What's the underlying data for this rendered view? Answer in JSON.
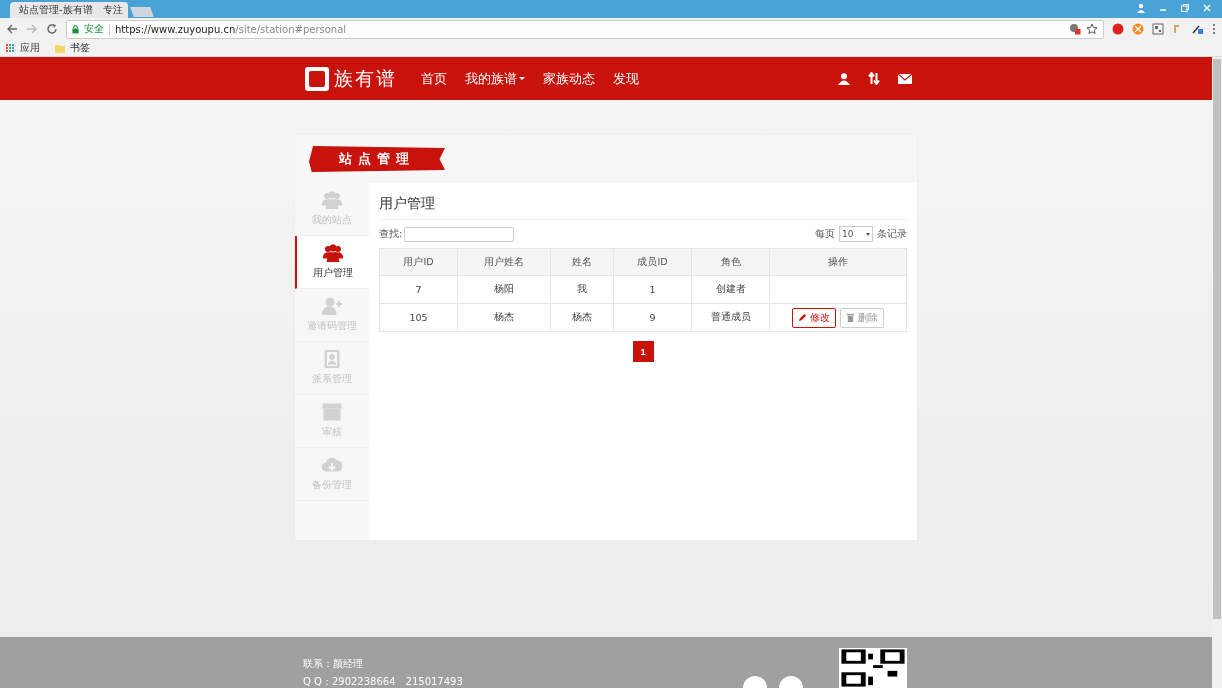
{
  "browser": {
    "tab_title": "站点管理-族有谱　专注",
    "security_label": "安全",
    "url_host": "https://www.zuyoupu.cn",
    "url_path": "/site/station#personal",
    "bookmarks": [
      {
        "kind": "apps",
        "label": "应用"
      },
      {
        "kind": "folder",
        "label": "书签"
      }
    ]
  },
  "header": {
    "logo_text": "族有谱",
    "nav": [
      {
        "label": "首页",
        "dropdown": false
      },
      {
        "label": "我的族谱",
        "dropdown": true
      },
      {
        "label": "家族动态",
        "dropdown": false
      },
      {
        "label": "发现",
        "dropdown": false
      }
    ]
  },
  "panel": {
    "banner": "站点管理",
    "sidebar": [
      {
        "kind": "site",
        "label": "我的站点",
        "selected": false
      },
      {
        "kind": "users",
        "label": "用户管理",
        "selected": true
      },
      {
        "kind": "invite",
        "label": "邀请码管理",
        "selected": false
      },
      {
        "kind": "branch",
        "label": "派系管理",
        "selected": false
      },
      {
        "kind": "review",
        "label": "审核",
        "selected": false
      },
      {
        "kind": "backup",
        "label": "备份管理",
        "selected": false
      }
    ],
    "title": "用户管理",
    "search_label": "查找:",
    "page_size_prefix": "每页",
    "page_size": "10",
    "page_size_suffix": "条记录",
    "table": {
      "columns": [
        "用户ID",
        "用户姓名",
        "姓名",
        "成员ID",
        "角色",
        "操作"
      ],
      "rows": [
        {
          "cells": [
            "7",
            "杨阳",
            "我",
            "1",
            "创建者"
          ],
          "actions": []
        },
        {
          "cells": [
            "105",
            "杨杰",
            "杨杰",
            "9",
            "普通成员"
          ],
          "actions": [
            {
              "kind": "edit",
              "label": "修改"
            },
            {
              "kind": "delete",
              "label": "删除"
            }
          ]
        }
      ]
    },
    "pages": [
      {
        "label": "1",
        "selected": true
      }
    ]
  },
  "footer": {
    "contact": "联系：颜经理",
    "qq": "Q Q：2902238664　215017493"
  }
}
